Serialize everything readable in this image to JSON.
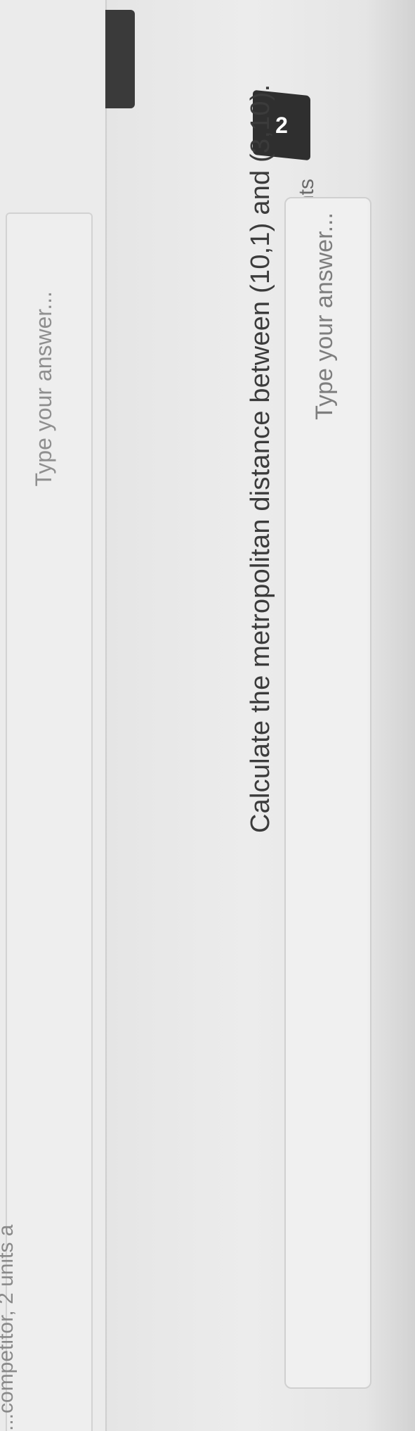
{
  "previous_question": {
    "text_tail": "...competitor, 2 units a",
    "answer_placeholder": "Type your answer..."
  },
  "question": {
    "number": "2",
    "type": "Formula",
    "points": "2 points",
    "text": "Calculate the metropolitan distance between (10,1) and (3,10).",
    "answer_placeholder": "Type your answer..."
  }
}
